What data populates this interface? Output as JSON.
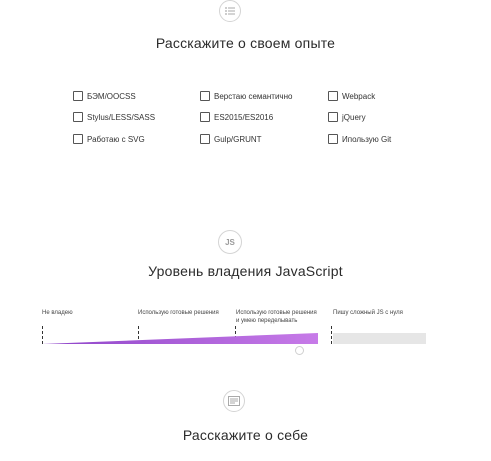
{
  "experience": {
    "title": "Расскажите о своем опыте",
    "icon": "list-icon",
    "skills": [
      "БЭМ/OOCSS",
      "Верстаю семантично",
      "Webpack",
      "Stylus/LESS/SASS",
      "ES2015/ES2016",
      "jQuery",
      "Работаю с SVG",
      "Gulp/GRUNT",
      "Ипользую Git"
    ]
  },
  "js_level": {
    "title": "Уровень владения JavaScript",
    "badge": "JS",
    "levels": [
      "Не владею",
      "Использую готовые решения",
      "Использую готовые решения",
      "и умею переделывать",
      "Пишу сложный JS с нуля"
    ],
    "accent_color": "#9b59d0",
    "track_color": "#e6e6e6",
    "selected_level_index": 2,
    "slider_value_fraction": 0.7
  },
  "about": {
    "title": "Расскажите о себе",
    "icon": "document-icon"
  }
}
